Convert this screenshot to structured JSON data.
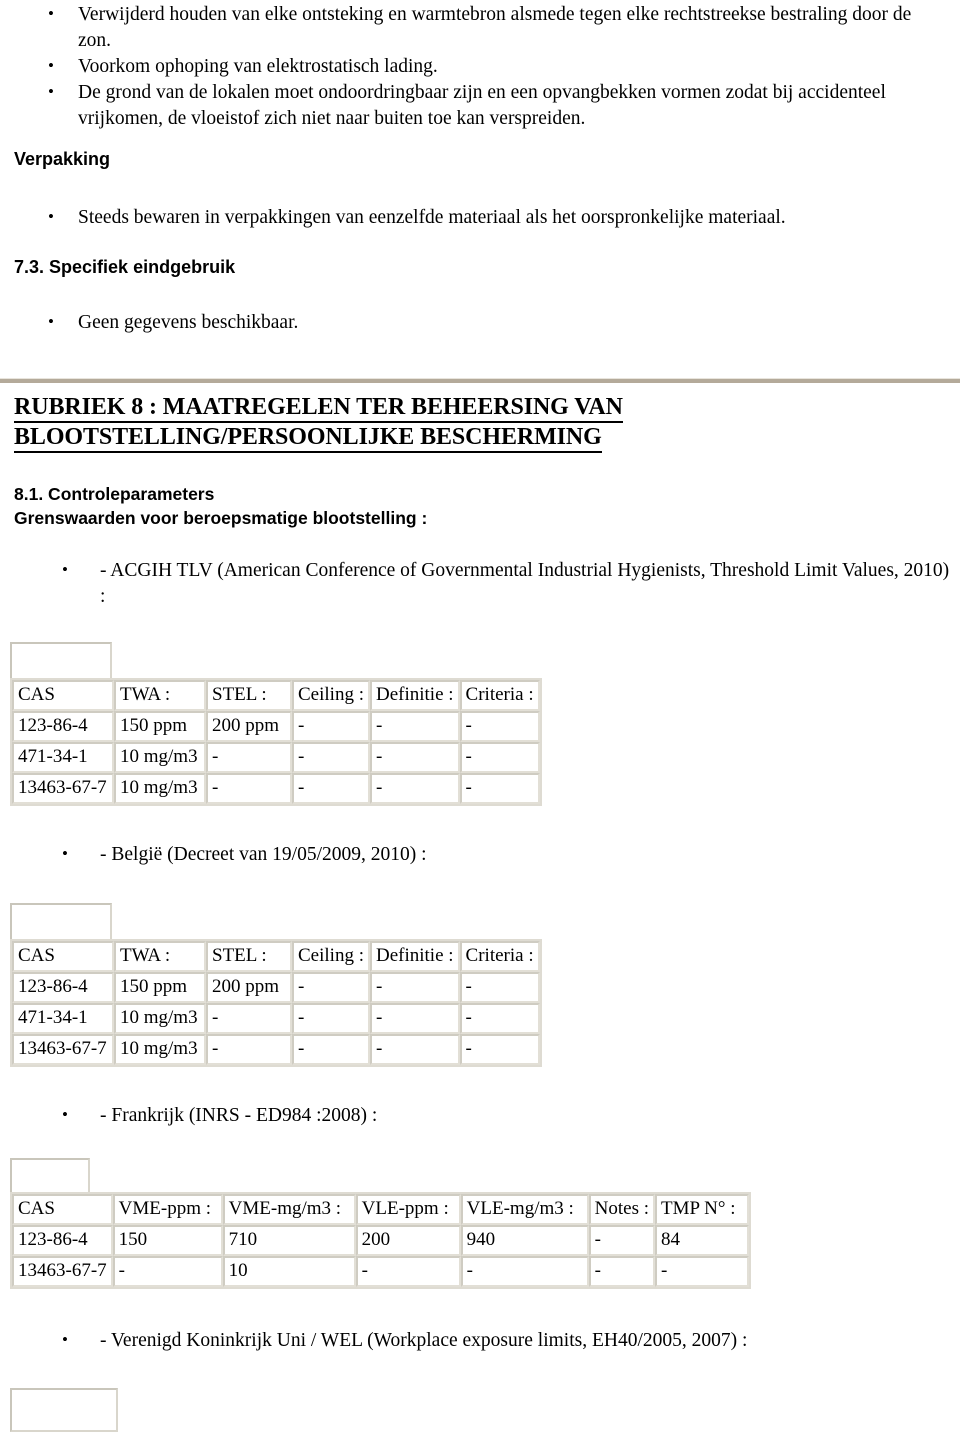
{
  "document": {
    "language": "nl",
    "top_bullets": [
      "Verwijderd houden van elke ontsteking en warmtebron alsmede tegen elke rechtstreekse bestraling door de zon.",
      "Voorkom ophoping van elektrostatisch lading.",
      "De grond van de lokalen moet ondoordringbaar zijn en een opvangbekken vormen zodat bij accidenteel vrijkomen, de vloeistof zich niet naar buiten toe kan verspreiden."
    ],
    "verpakking": {
      "heading": "Verpakking",
      "bullets": [
        "Steeds bewaren in verpakkingen van eenzelfde materiaal als het oorspronkelijke materiaal."
      ]
    },
    "eindgebruik": {
      "heading": "7.3. Specifiek eindgebruik",
      "bullets": [
        "Geen gegevens beschikbaar."
      ]
    },
    "rubriek8": {
      "title_line1": "RUBRIEK 8 : MAATREGELEN TER BEHEERSING VAN",
      "title_line2": "BLOOTSTELLING/PERSOONLIJKE BESCHERMING",
      "subsection_number_title": "8.1. Controleparameters",
      "subsection_subtitle": "Grenswaarden voor beroepsmatige blootstelling :",
      "divider_color": "#b4aa9a"
    },
    "sources": {
      "acgih": "- ACGIH TLV (American Conference of Governmental Industrial Hygienists, Threshold Limit Values, 2010) :",
      "belgie": "- België (Decreet van 19/05/2009, 2010) :",
      "frankrijk": "- Frankrijk (INRS - ED984 :2008) :",
      "uk": "- Verenigd Koninkrijk Uni / WEL (Workplace exposure limits, EH40/2005, 2007) :"
    },
    "tables": {
      "acgih": {
        "headers": [
          "CAS",
          "TWA :",
          "STEL :",
          "Ceiling :",
          "Definitie :",
          "Criteria :"
        ],
        "rows": [
          [
            "123-86-4",
            "150 ppm",
            "200 ppm",
            "-",
            "-",
            "-"
          ],
          [
            "471-34-1",
            "10 mg/m3",
            "-",
            "-",
            "-",
            "-"
          ],
          [
            "13463-67-7",
            "10 mg/m3",
            "-",
            "-",
            "-",
            "-"
          ]
        ]
      },
      "belgie": {
        "headers": [
          "CAS",
          "TWA :",
          "STEL :",
          "Ceiling :",
          "Definitie :",
          "Criteria :"
        ],
        "rows": [
          [
            "123-86-4",
            "150 ppm",
            "200 ppm",
            "-",
            "-",
            "-"
          ],
          [
            "471-34-1",
            "10 mg/m3",
            "-",
            "-",
            "-",
            "-"
          ],
          [
            "13463-67-7",
            "10 mg/m3",
            "-",
            "-",
            "-",
            "-"
          ]
        ]
      },
      "frankrijk": {
        "headers": [
          "CAS",
          "VME-ppm :",
          "VME-mg/m3 :",
          "VLE-ppm :",
          "VLE-mg/m3 :",
          "Notes :",
          "TMP N° :"
        ],
        "rows": [
          [
            "123-86-4",
            "150",
            "710",
            "200",
            "940",
            "-",
            "84"
          ],
          [
            "13463-67-7",
            "-",
            "10",
            "-",
            "-",
            "-",
            "-"
          ]
        ]
      }
    }
  }
}
